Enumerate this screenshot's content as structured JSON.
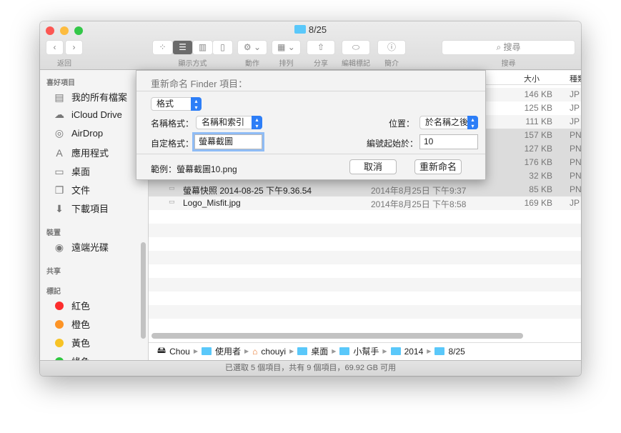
{
  "window": {
    "title": "8/25"
  },
  "toolbar": {
    "back_label": "返回",
    "view_label": "顯示方式",
    "action_label": "動作",
    "arrange_label": "排列",
    "share_label": "分享",
    "tags_label": "編輯標記",
    "info_label": "簡介",
    "search_label": "搜尋",
    "search_placeholder": "搜尋"
  },
  "sidebar": {
    "favorites_header": "喜好項目",
    "favorites": [
      {
        "label": "我的所有檔案",
        "icon": "all-files-icon"
      },
      {
        "label": "iCloud Drive",
        "icon": "cloud-icon"
      },
      {
        "label": "AirDrop",
        "icon": "airdrop-icon"
      },
      {
        "label": "應用程式",
        "icon": "applications-icon"
      },
      {
        "label": "桌面",
        "icon": "desktop-icon"
      },
      {
        "label": "文件",
        "icon": "documents-icon"
      },
      {
        "label": "下載項目",
        "icon": "downloads-icon"
      }
    ],
    "devices_header": "裝置",
    "devices": [
      {
        "label": "遠端光碟",
        "icon": "disc-icon"
      }
    ],
    "shared_header": "共享",
    "tags_header": "標記",
    "tags": [
      {
        "label": "紅色",
        "color": "#fc2d2d"
      },
      {
        "label": "橙色",
        "color": "#fd9426"
      },
      {
        "label": "黃色",
        "color": "#f7c325"
      },
      {
        "label": "綠色",
        "color": "#2ec840"
      }
    ]
  },
  "list": {
    "columns": {
      "size": "大小",
      "kind": "種類"
    },
    "rows": [
      {
        "name": "",
        "date": "",
        "size": "146 KB",
        "kind": "JP",
        "selected": false
      },
      {
        "name": "",
        "date": "",
        "size": "125 KB",
        "kind": "JP",
        "selected": false
      },
      {
        "name": "",
        "date": "",
        "size": "111 KB",
        "kind": "JP",
        "selected": false
      },
      {
        "name": "",
        "date": "",
        "size": "157 KB",
        "kind": "PN",
        "selected": true
      },
      {
        "name": "",
        "date": "",
        "size": "127 KB",
        "kind": "PN",
        "selected": true
      },
      {
        "name": "",
        "date": "",
        "size": "176 KB",
        "kind": "PN",
        "selected": true
      },
      {
        "name": "",
        "date": "",
        "size": "32 KB",
        "kind": "PN",
        "selected": true
      },
      {
        "name": "螢幕快照 2014-08-25 下午9.36.54",
        "date": "2014年8月25日 下午9:37",
        "size": "85 KB",
        "kind": "PN",
        "selected": true
      },
      {
        "name": "Logo_Misfit.jpg",
        "date": "2014年8月25日 下午8:58",
        "size": "169 KB",
        "kind": "JP",
        "selected": false
      }
    ]
  },
  "path": [
    {
      "label": "Chou",
      "icon": "disk-icon"
    },
    {
      "label": "使用者",
      "icon": "users-folder-icon"
    },
    {
      "label": "chouyi",
      "icon": "home-icon"
    },
    {
      "label": "桌面",
      "icon": "desktop-folder-icon"
    },
    {
      "label": "小幫手",
      "icon": "folder-icon"
    },
    {
      "label": "2014",
      "icon": "folder-icon"
    },
    {
      "label": "8/25",
      "icon": "folder-icon"
    }
  ],
  "status": "已選取 5 個項目，共有 9 個項目，69.92 GB 可用",
  "dialog": {
    "title": "重新命名 Finder 項目：",
    "mode": "格式",
    "name_format_label": "名稱格式：",
    "name_format_value": "名稱和索引",
    "position_label": "位置：",
    "position_value": "於名稱之後",
    "custom_format_label": "自定格式：",
    "custom_format_value": "螢幕截圖",
    "start_label": "編號起始於：",
    "start_value": "10",
    "example": "範例：螢幕截圖10.png",
    "cancel": "取消",
    "rename": "重新命名"
  },
  "colors": {
    "accent": "#2d7ef7",
    "selection": "#dcdcdc"
  }
}
